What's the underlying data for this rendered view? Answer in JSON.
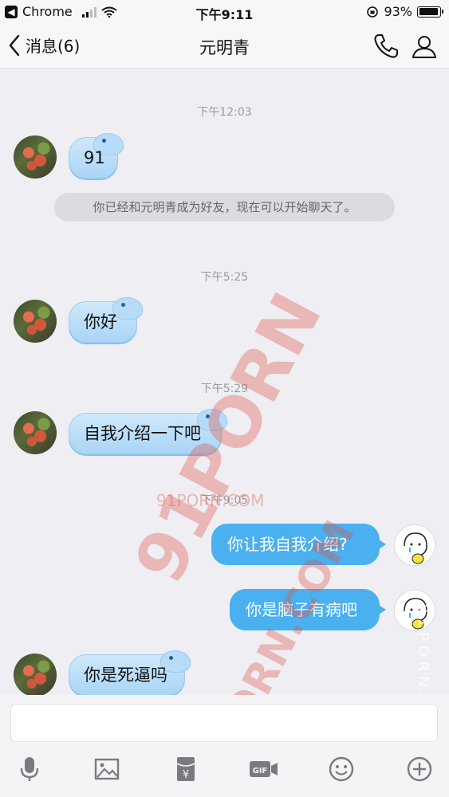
{
  "status_bar": {
    "back_app": "Chrome",
    "time": "下午9:11",
    "battery": "93%"
  },
  "nav": {
    "back_label": "消息(6)",
    "title": "元明青"
  },
  "messages": [
    {
      "type": "time",
      "text": "下午12:03"
    },
    {
      "type": "in",
      "text": "91"
    },
    {
      "type": "system",
      "text": "你已经和元明青成为好友，现在可以开始聊天了。"
    },
    {
      "type": "time",
      "text": "下午5:25"
    },
    {
      "type": "in",
      "text": "你好"
    },
    {
      "type": "time",
      "text": "下午5:29"
    },
    {
      "type": "in",
      "text": "自我介绍一下吧"
    },
    {
      "type": "time",
      "text": "下午9:05"
    },
    {
      "type": "out",
      "text": "你让我自我介绍?"
    },
    {
      "type": "out",
      "text": "你是脑子有病吧"
    },
    {
      "type": "in",
      "text": "你是死逼吗"
    }
  ],
  "watermarks": {
    "small": "91PORN.COM",
    "big1": "91PORN",
    "big2": "91PORN.COM",
    "vertical": "91PORN.COM"
  },
  "toolbar": {
    "icons": [
      "microphone-icon",
      "image-icon",
      "red-packet-icon",
      "gif-icon",
      "emoji-icon",
      "plus-icon"
    ],
    "red_packet_symbol": "¥",
    "gif_label": "GIF"
  },
  "colors": {
    "incoming_bubble": "#a9d5f6",
    "outgoing_bubble": "#4ab0ef",
    "background": "#eeeef3"
  }
}
